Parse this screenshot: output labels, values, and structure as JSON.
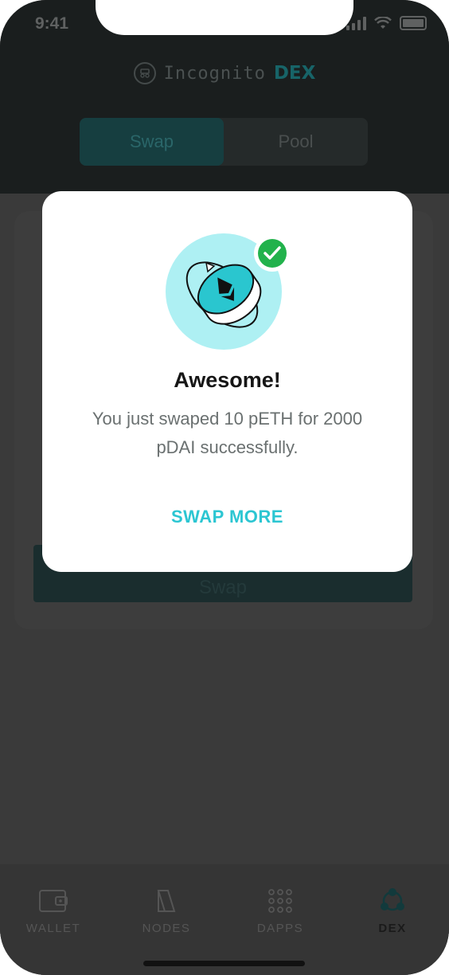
{
  "status_bar": {
    "time": "9:41"
  },
  "header": {
    "brand_name": "Incognito",
    "brand_suffix": "DEX"
  },
  "segmented": {
    "tabs": [
      {
        "label": "Swap",
        "active": true
      },
      {
        "label": "Pool",
        "active": false
      }
    ]
  },
  "background_swap_button": "Swap",
  "modal": {
    "title": "Awesome!",
    "message": "You just swaped 10 pETH for 2000 pDAI successfully.",
    "action_label": "SWAP MORE"
  },
  "tabbar": {
    "items": [
      {
        "label": "WALLET",
        "icon": "wallet-icon",
        "active": false
      },
      {
        "label": "NODES",
        "icon": "nodes-icon",
        "active": false
      },
      {
        "label": "DAPPS",
        "icon": "dapps-icon",
        "active": false
      },
      {
        "label": "DEX",
        "icon": "dex-icon",
        "active": true
      }
    ]
  },
  "colors": {
    "accent": "#2cc6d2",
    "success": "#22b24c",
    "illustration_bg": "#aef0f3",
    "overlay": "#3a3a3a"
  }
}
